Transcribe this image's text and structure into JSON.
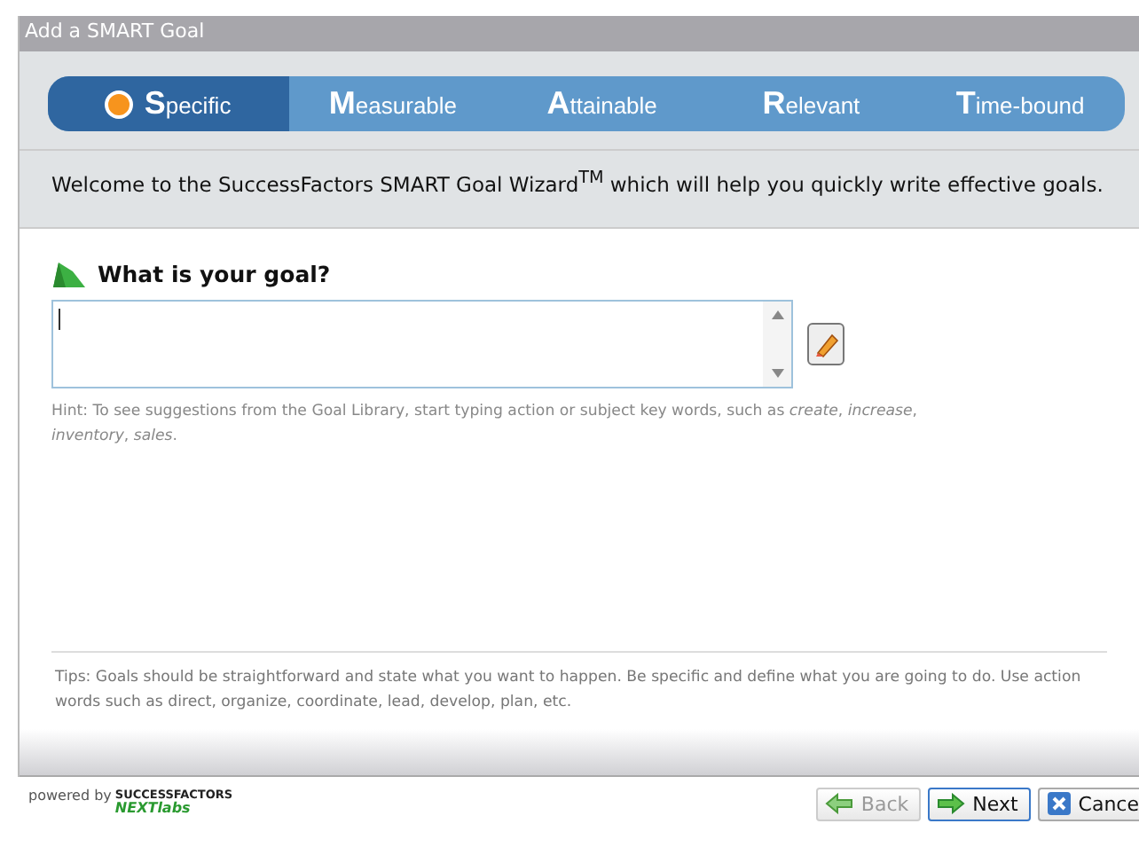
{
  "window": {
    "title": "Add a SMART Goal"
  },
  "steps": [
    {
      "label": "**S**pecific",
      "selected": true
    },
    {
      "label": "**M**easurable",
      "selected": false
    },
    {
      "label": "**A**ttainable",
      "selected": false
    },
    {
      "label": "**R**elevant",
      "selected": false
    },
    {
      "label": "**T**ime-bound",
      "selected": false
    }
  ],
  "welcome": "Welcome to the SuccessFactors SMART Goal Wizard$^{TM}$ which will help you quickly write effective goals.",
  "goal": {
    "heading": "What is your goal?",
    "hint": "Hint: To see suggestions from the Goal Library, start typing action or subject key words, such as *create*, *increase*, *inventory*, *sales*."
  },
  "tips": "Tips: Goals should be straightforward and state what you want to happen. Be specific and define what you are going to do. Use action words such as direct, organize, coordinate, lead, develop, plan, etc.",
  "footer": {
    "powered_by": "powered by",
    "brand": "SUCCESSFACTORS",
    "brand_sub": "NEXTlabs"
  },
  "buttons": [
    {
      "label": "Back",
      "kind": "back",
      "disabled": true
    },
    {
      "label": "Next",
      "kind": "next",
      "disabled": false
    },
    {
      "label": "Cance",
      "kind": "cancel",
      "disabled": false
    }
  ]
}
